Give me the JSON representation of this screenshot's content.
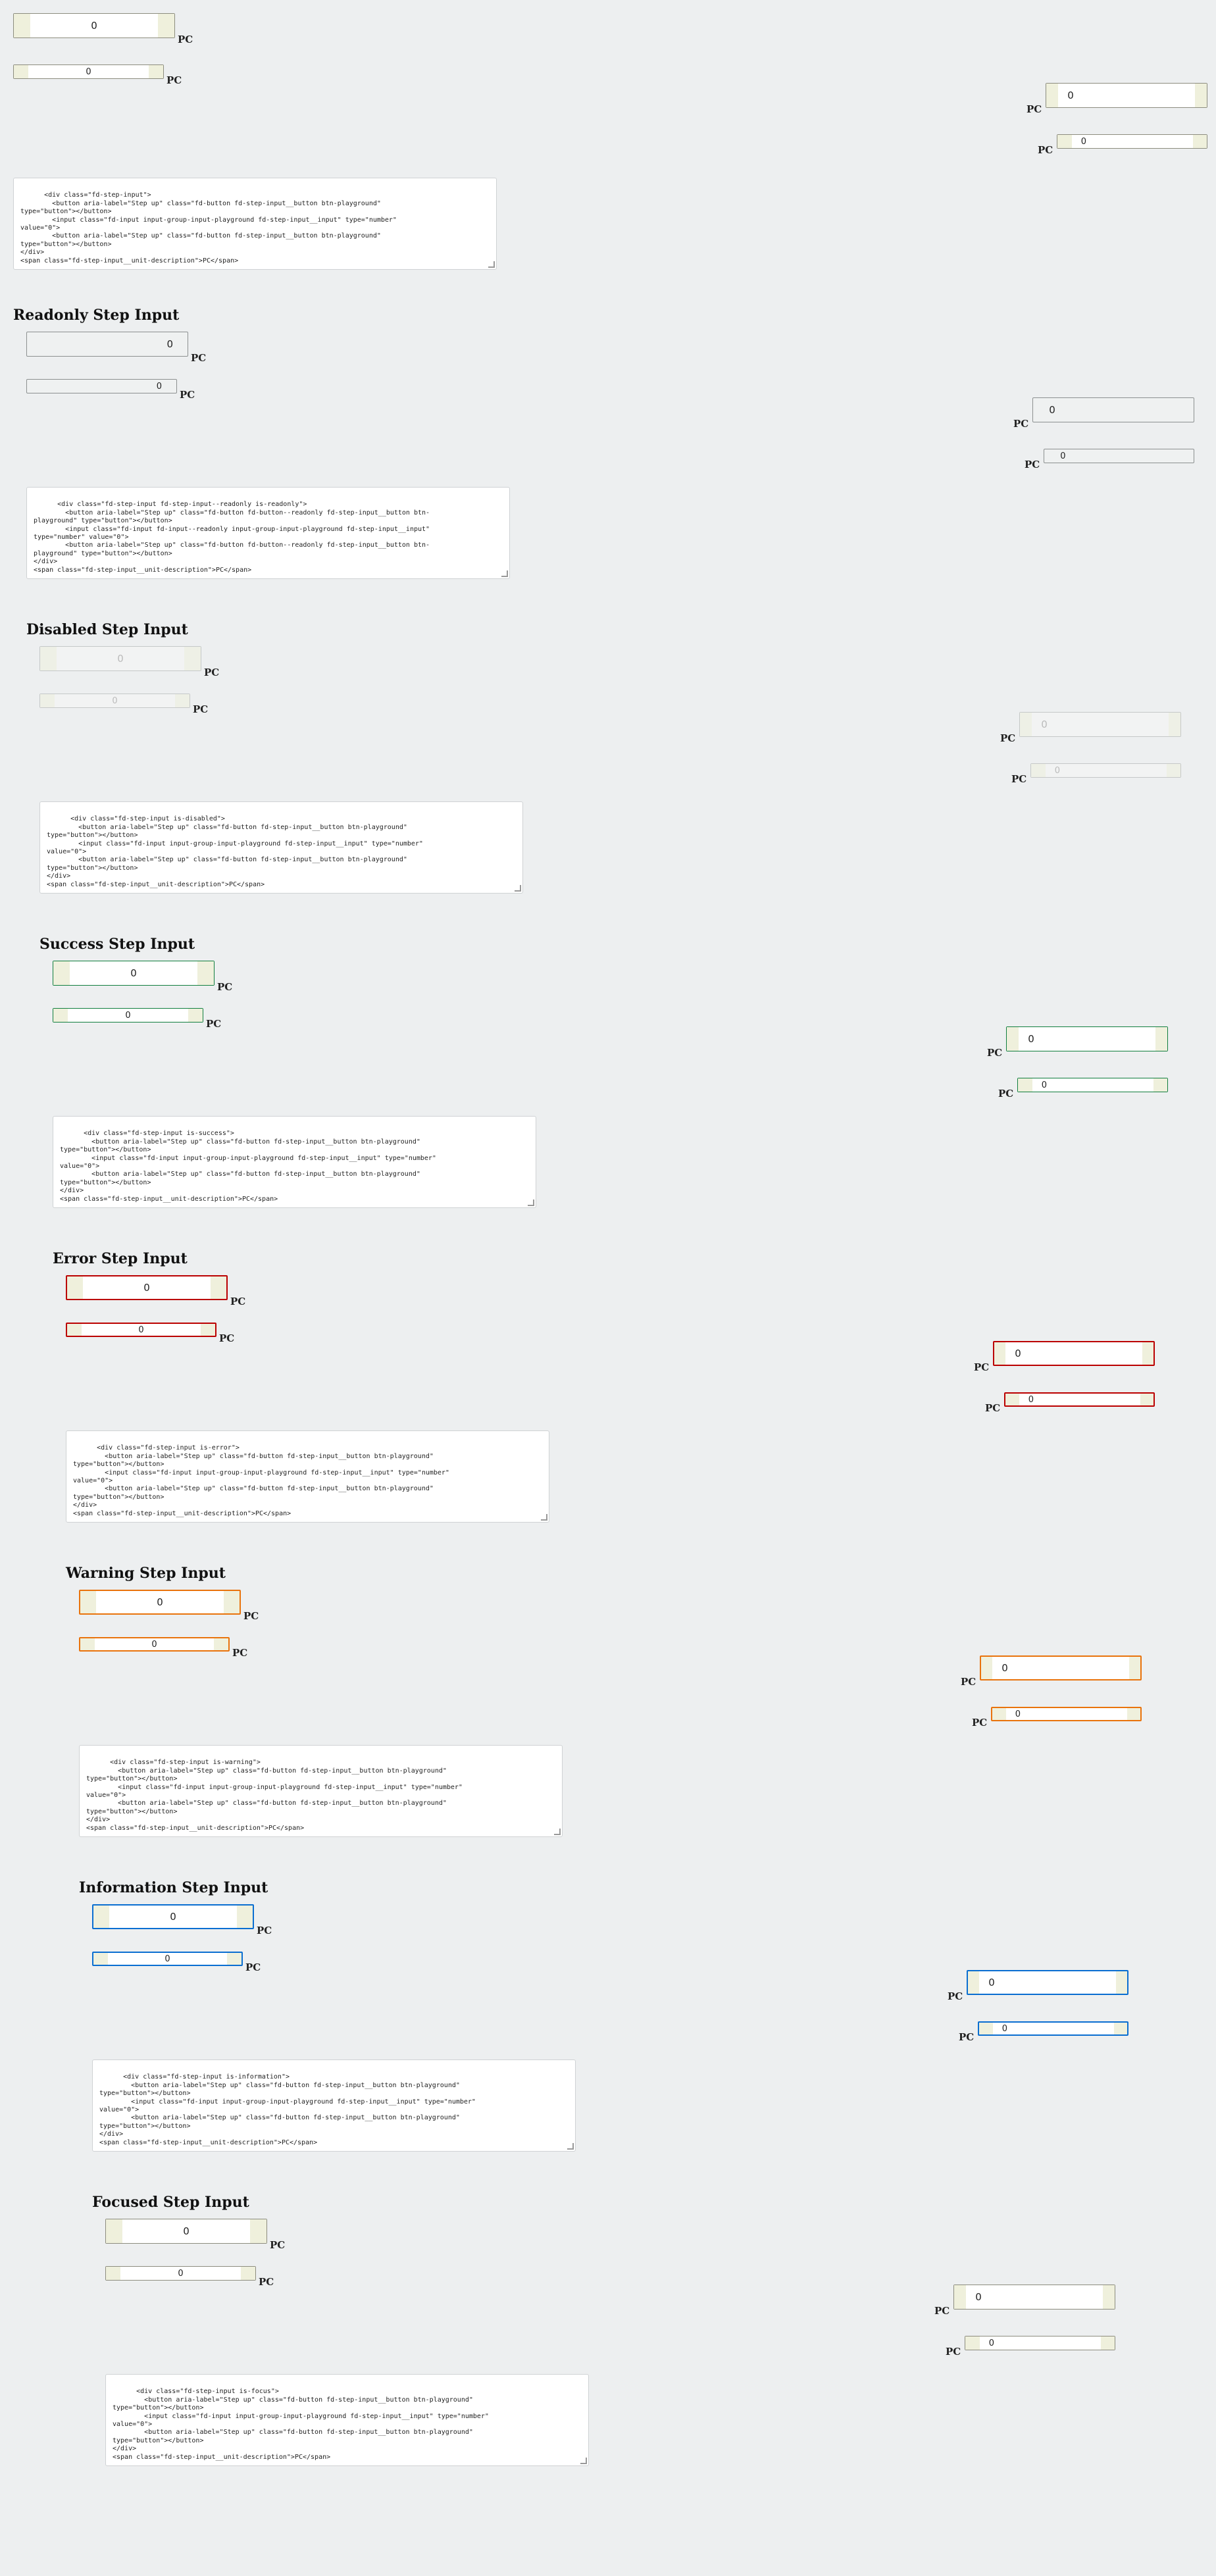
{
  "unit": "PC",
  "value": "0",
  "sections": [
    {
      "title": "",
      "code": "<div class=\"fd-step-input\">\n        <button aria-label=\"Step up\" class=\"fd-button fd-step-input__button btn-playground\"\ntype=\"button\"></button>\n        <input class=\"fd-input input-group-input-playground fd-step-input__input\" type=\"number\"\nvalue=\"0\">\n        <button aria-label=\"Step up\" class=\"fd-button fd-step-input__button btn-playground\"\ntype=\"button\"></button>\n</div>\n<span class=\"fd-step-input__unit-description\">PC</span>\n\n<br/>"
    },
    {
      "title": "Readonly Step Input",
      "code": "<div class=\"fd-step-input fd-step-input--readonly is-readonly\">\n        <button aria-label=\"Step up\" class=\"fd-button fd-button--readonly fd-step-input__button btn-\nplayground\" type=\"button\"></button>\n        <input class=\"fd-input fd-input--readonly input-group-input-playground fd-step-input__input\"\ntype=\"number\" value=\"0\">\n        <button aria-label=\"Step up\" class=\"fd-button fd-button--readonly fd-step-input__button btn-\nplayground\" type=\"button\"></button>\n</div>\n<span class=\"fd-step-input__unit-description\">PC</span>\n\n<br/>"
    },
    {
      "title": "Disabled Step Input",
      "code": "<div class=\"fd-step-input is-disabled\">\n        <button aria-label=\"Step up\" class=\"fd-button fd-step-input__button btn-playground\"\ntype=\"button\"></button>\n        <input class=\"fd-input input-group-input-playground fd-step-input__input\" type=\"number\"\nvalue=\"0\">\n        <button aria-label=\"Step up\" class=\"fd-button fd-step-input__button btn-playground\"\ntype=\"button\"></button>\n</div>\n<span class=\"fd-step-input__unit-description\">PC</span>\n\n<br/>"
    },
    {
      "title": "Success Step Input",
      "code": "<div class=\"fd-step-input is-success\">\n        <button aria-label=\"Step up\" class=\"fd-button fd-step-input__button btn-playground\"\ntype=\"button\"></button>\n        <input class=\"fd-input input-group-input-playground fd-step-input__input\" type=\"number\"\nvalue=\"0\">\n        <button aria-label=\"Step up\" class=\"fd-button fd-step-input__button btn-playground\"\ntype=\"button\"></button>\n</div>\n<span class=\"fd-step-input__unit-description\">PC</span>\n\n<br/>"
    },
    {
      "title": "Error Step Input",
      "code": "<div class=\"fd-step-input is-error\">\n        <button aria-label=\"Step up\" class=\"fd-button fd-step-input__button btn-playground\"\ntype=\"button\"></button>\n        <input class=\"fd-input input-group-input-playground fd-step-input__input\" type=\"number\"\nvalue=\"0\">\n        <button aria-label=\"Step up\" class=\"fd-button fd-step-input__button btn-playground\"\ntype=\"button\"></button>\n</div>\n<span class=\"fd-step-input__unit-description\">PC</span>\n\n<br/>"
    },
    {
      "title": "Warning Step Input",
      "code": "<div class=\"fd-step-input is-warning\">\n        <button aria-label=\"Step up\" class=\"fd-button fd-step-input__button btn-playground\"\ntype=\"button\"></button>\n        <input class=\"fd-input input-group-input-playground fd-step-input__input\" type=\"number\"\nvalue=\"0\">\n        <button aria-label=\"Step up\" class=\"fd-button fd-step-input__button btn-playground\"\ntype=\"button\"></button>\n</div>\n<span class=\"fd-step-input__unit-description\">PC</span>\n\n<br/>"
    },
    {
      "title": "Information Step Input",
      "code": "<div class=\"fd-step-input is-information\">\n        <button aria-label=\"Step up\" class=\"fd-button fd-step-input__button btn-playground\"\ntype=\"button\"></button>\n        <input class=\"fd-input input-group-input-playground fd-step-input__input\" type=\"number\"\nvalue=\"0\">\n        <button aria-label=\"Step up\" class=\"fd-button fd-step-input__button btn-playground\"\ntype=\"button\"></button>\n</div>\n<span class=\"fd-step-input__unit-description\">PC</span>\n\n<br/>"
    },
    {
      "title": "Focused Step Input",
      "code": "<div class=\"fd-step-input is-focus\">\n        <button aria-label=\"Step up\" class=\"fd-button fd-step-input__button btn-playground\"\ntype=\"button\"></button>\n        <input class=\"fd-input input-group-input-playground fd-step-input__input\" type=\"number\"\nvalue=\"0\">\n        <button aria-label=\"Step up\" class=\"fd-button fd-step-input__button btn-playground\"\ntype=\"button\"></button>\n</div>\n<span class=\"fd-step-input__unit-description\">PC</span>\n\n<br/>"
    }
  ]
}
